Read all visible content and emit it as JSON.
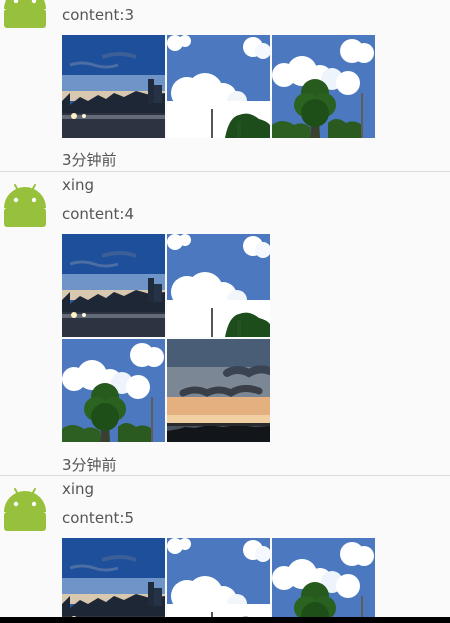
{
  "posts": [
    {
      "name": "",
      "content": "content:3",
      "time": "3分钟前",
      "images": [
        "dusk-street-photo",
        "cloud-sky-photo",
        "tree-sky-photo"
      ]
    },
    {
      "name": "xing",
      "content": "content:4",
      "time": "3分钟前",
      "images": [
        "dusk-street-photo",
        "cloud-sky-photo",
        "tree-sky-photo",
        "sunset-clouds-photo"
      ]
    },
    {
      "name": "xing",
      "content": "content:5",
      "time": "",
      "images": [
        "dusk-street-photo",
        "cloud-sky-photo",
        "tree-sky-photo"
      ]
    }
  ],
  "colors": {
    "android_green": "#97c03d",
    "text": "#555555",
    "divider": "#dcdcdc",
    "background": "#fafafa"
  }
}
